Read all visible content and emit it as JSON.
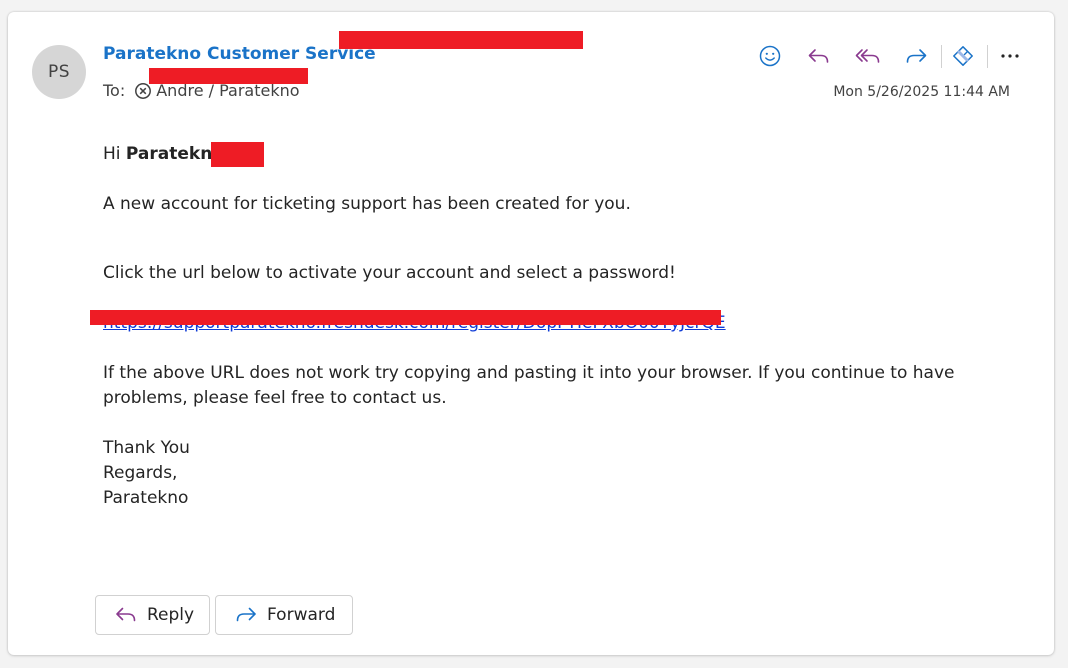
{
  "message": {
    "avatar_initials": "PS",
    "sender_name": "Paratekno Customer Service",
    "to_label": "To:",
    "recipient": "Andre / Paratekno",
    "date": "Mon 5/26/2025 11:44 AM"
  },
  "toolbar": {
    "icons": [
      "emoji-icon",
      "reply-icon",
      "reply-all-icon",
      "forward-icon",
      "copilot-icon",
      "more-icon"
    ]
  },
  "body": {
    "greeting_prefix": "Hi",
    "greeting_name": "Paratekno",
    "line1": "A new account for ticketing support has been created for you.",
    "line2": "Click the url below to activate your account and select a password!",
    "url": "https://supportparatekno.freshdesk.com/register/D6pFTIeFXbO00YyJcrQE",
    "line3a": "If the above URL does not work try copying and pasting it into your browser. If you continue to have",
    "line3b": "problems, please feel free to contact us.",
    "sign1": "Thank You",
    "sign2": "Regards,",
    "sign3": "Paratekno"
  },
  "actions": {
    "reply_label": "Reply",
    "forward_label": "Forward"
  },
  "colors": {
    "accent": "#1a73c8",
    "reply_purple": "#8a3a8f",
    "redaction": "#ee1c25"
  }
}
